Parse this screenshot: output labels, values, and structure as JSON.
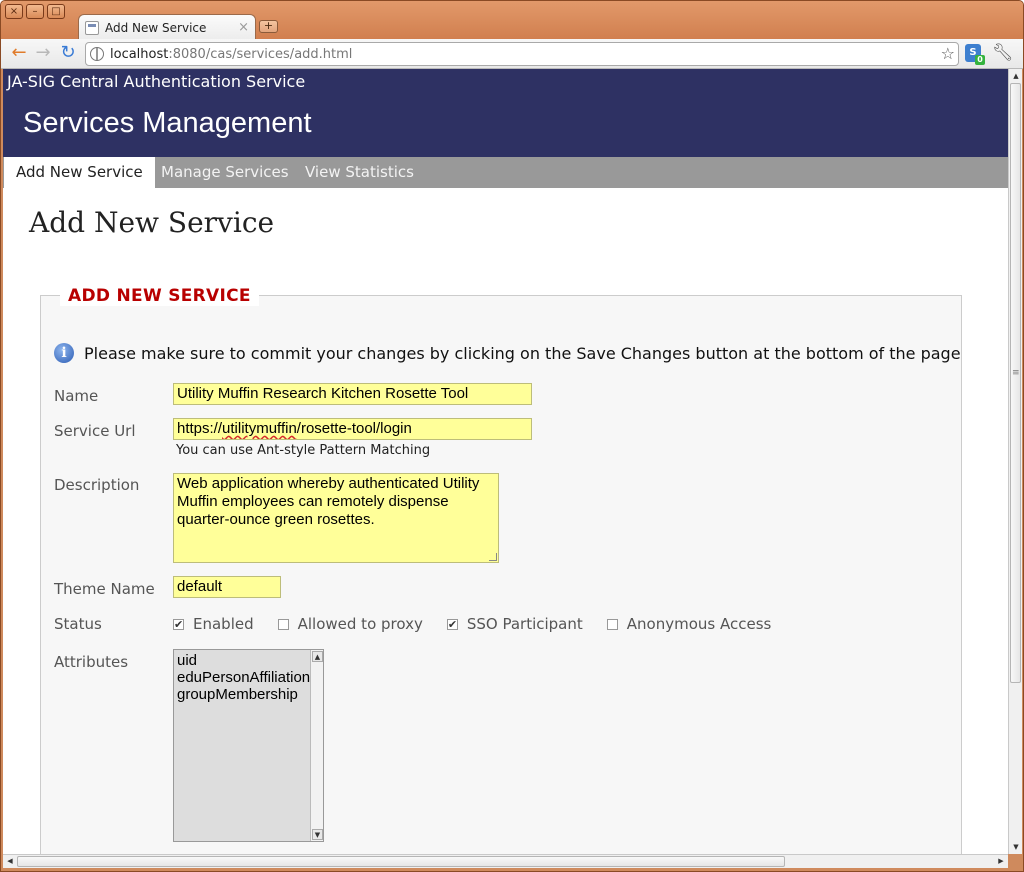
{
  "browser": {
    "window_buttons": [
      "×",
      "–",
      "□"
    ],
    "tab_title": "Add New Service",
    "tab_close": "×",
    "new_tab": "+",
    "url_host": "localhost",
    "url_rest": ":8080/cas/services/add.html",
    "icons": [
      "back-arrow-icon",
      "forward-arrow-icon",
      "reload-icon",
      "globe-icon",
      "bookmark-star-icon",
      "extension-icon",
      "wrench-icon"
    ]
  },
  "header": {
    "site_name": "JA-SIG Central Authentication Service",
    "app_title": "Services Management",
    "bg_color": "#2e3163"
  },
  "nav": {
    "items": [
      {
        "label": "Add New Service",
        "active": true
      },
      {
        "label": "Manage Services",
        "active": false
      },
      {
        "label": "View Statistics",
        "active": false
      }
    ]
  },
  "main": {
    "page_title": "Add New Service",
    "fieldset_legend": "ADD NEW SERVICE",
    "legend_color": "#b80000",
    "info_message": "Please make sure to commit your changes by clicking on the Save Changes button at the bottom of the page"
  },
  "form": {
    "name_label": "Name",
    "name_value": "Utility Muffin Research Kitchen Rosette Tool",
    "url_label": "Service Url",
    "url_value_a": "https://",
    "url_value_b": "utilitymuffin",
    "url_value_c": "/rosette-tool/login",
    "url_hint": "You can use Ant-style Pattern Matching",
    "description_label": "Description",
    "description_value": "Web application whereby authenticated Utility Muffin employees can remotely dispense quarter-ounce green rosettes.",
    "theme_label": "Theme Name",
    "theme_value": "default",
    "status_label": "Status",
    "status_options": [
      {
        "label": "Enabled",
        "checked": true
      },
      {
        "label": "Allowed to proxy",
        "checked": false
      },
      {
        "label": "SSO Participant",
        "checked": true
      },
      {
        "label": "Anonymous Access",
        "checked": false
      }
    ],
    "attributes_label": "Attributes",
    "attributes": [
      "uid",
      "eduPersonAffiliation",
      "groupMembership"
    ]
  }
}
